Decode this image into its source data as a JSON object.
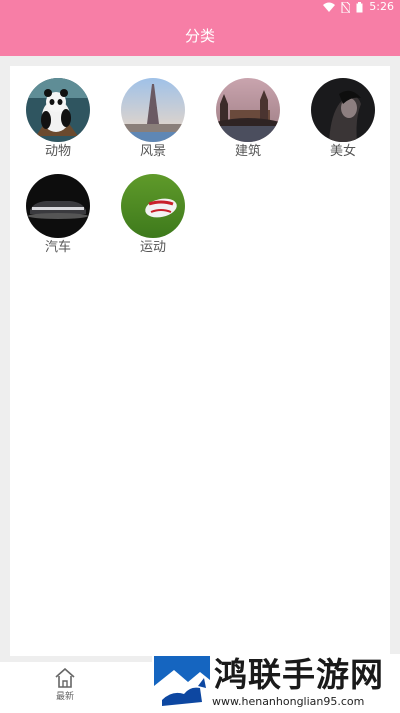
{
  "status_bar": {
    "time": "5:26"
  },
  "app_bar": {
    "title": "分类"
  },
  "categories": [
    {
      "label": "动物"
    },
    {
      "label": "风景"
    },
    {
      "label": "建筑"
    },
    {
      "label": "美女"
    },
    {
      "label": "汽车"
    },
    {
      "label": "运动"
    }
  ],
  "bottom_nav": {
    "home_label": "最新"
  },
  "watermark": {
    "title": "鸿联手游网",
    "url": "www.henanhonglian95.com"
  },
  "colors": {
    "accent": "#f77ea6",
    "background": "#eeeeee"
  }
}
